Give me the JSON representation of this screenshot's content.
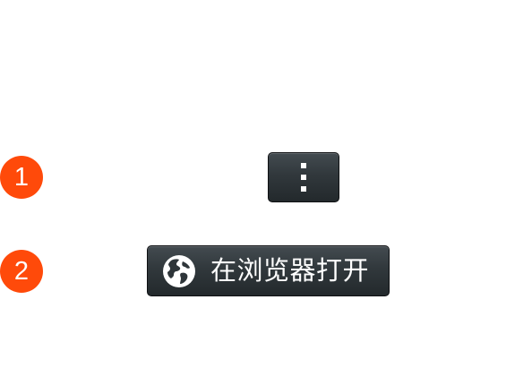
{
  "steps": [
    {
      "number": "1",
      "color": "#ff4a0a"
    },
    {
      "number": "2",
      "color": "#ff4a0a"
    }
  ],
  "more_button": {
    "icon": "vertical-ellipsis-icon"
  },
  "open_in_browser_button": {
    "icon": "globe-icon",
    "label": "在浏览器打开"
  },
  "colors": {
    "badge": "#ff4a0a",
    "button_bg": "#2e3539",
    "button_text": "#ffffff",
    "background": "#ffffff"
  }
}
